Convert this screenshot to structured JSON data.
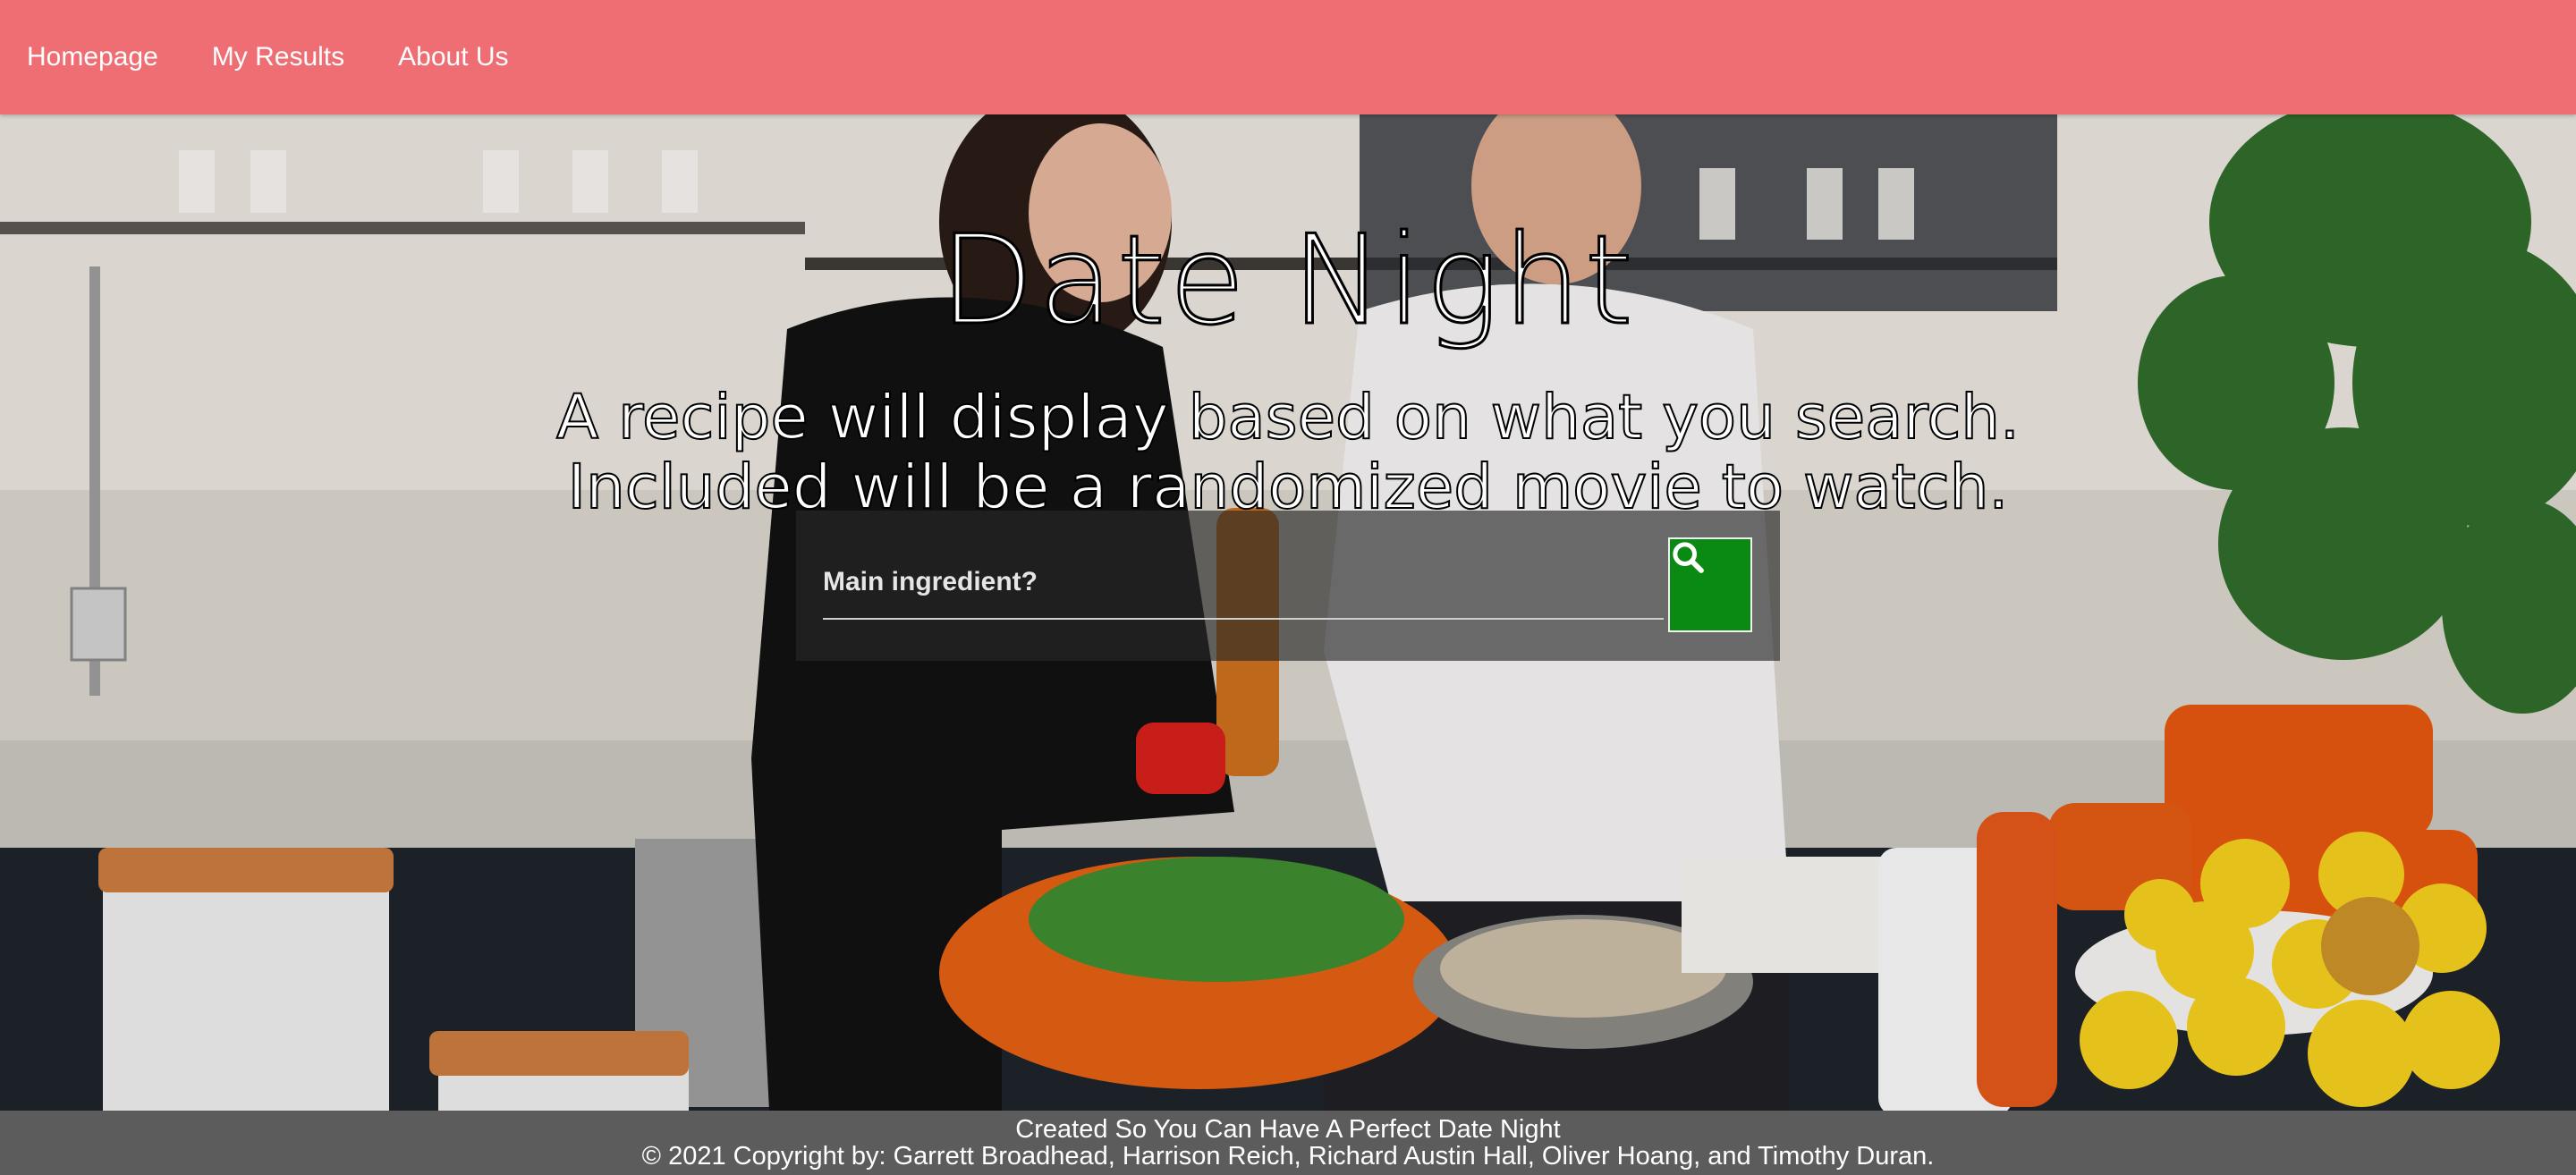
{
  "nav": {
    "items": [
      {
        "label": "Homepage"
      },
      {
        "label": "My Results"
      },
      {
        "label": "About Us"
      }
    ],
    "background": "#ee6e73"
  },
  "hero": {
    "title": "Date Night",
    "subtitle_line1": "A recipe will display based on what you search.",
    "subtitle_line2": "Included will be a randomized movie to watch.",
    "background_image": "couple-cooking-in-kitchen"
  },
  "search": {
    "placeholder": "Main ingredient?",
    "value": "",
    "button_icon": "search-icon",
    "button_color": "#0a8a12"
  },
  "footer": {
    "line1": "Created So You Can Have A Perfect Date Night",
    "line2": "© 2021 Copyright by: Garrett Broadhead, Harrison Reich, Richard Austin Hall, Oliver Hoang, and Timothy Duran."
  }
}
